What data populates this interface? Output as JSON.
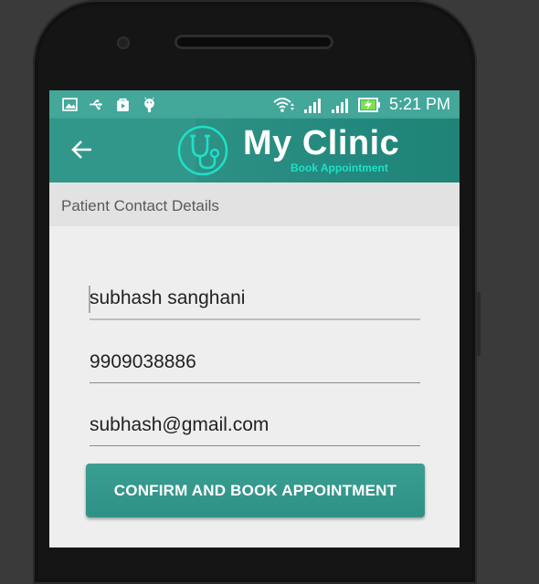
{
  "status_bar": {
    "time": "5:21 PM",
    "icons": [
      "image-icon",
      "usb-icon",
      "shopping-bag-icon",
      "android-icon",
      "wifi-icon",
      "signal-icon",
      "signal-icon",
      "battery-charging-icon"
    ]
  },
  "app_bar": {
    "back_icon": "arrow-back-icon",
    "logo_icon": "stethoscope-icon",
    "title": "My Clinic",
    "subtitle": "Book Appointment"
  },
  "section": {
    "title": "Patient Contact Details"
  },
  "form": {
    "name_value": "subhash sanghani",
    "phone_value": "9909038886",
    "email_value": "subhash@gmail.com",
    "submit_label": "CONFIRM AND BOOK APPOINTMENT"
  },
  "colors": {
    "status_bar": "#43a79a",
    "app_bar": "#32978b",
    "accent": "#1fe0c8",
    "button": "#3a9e92",
    "screen_bg": "#eeeeee"
  }
}
